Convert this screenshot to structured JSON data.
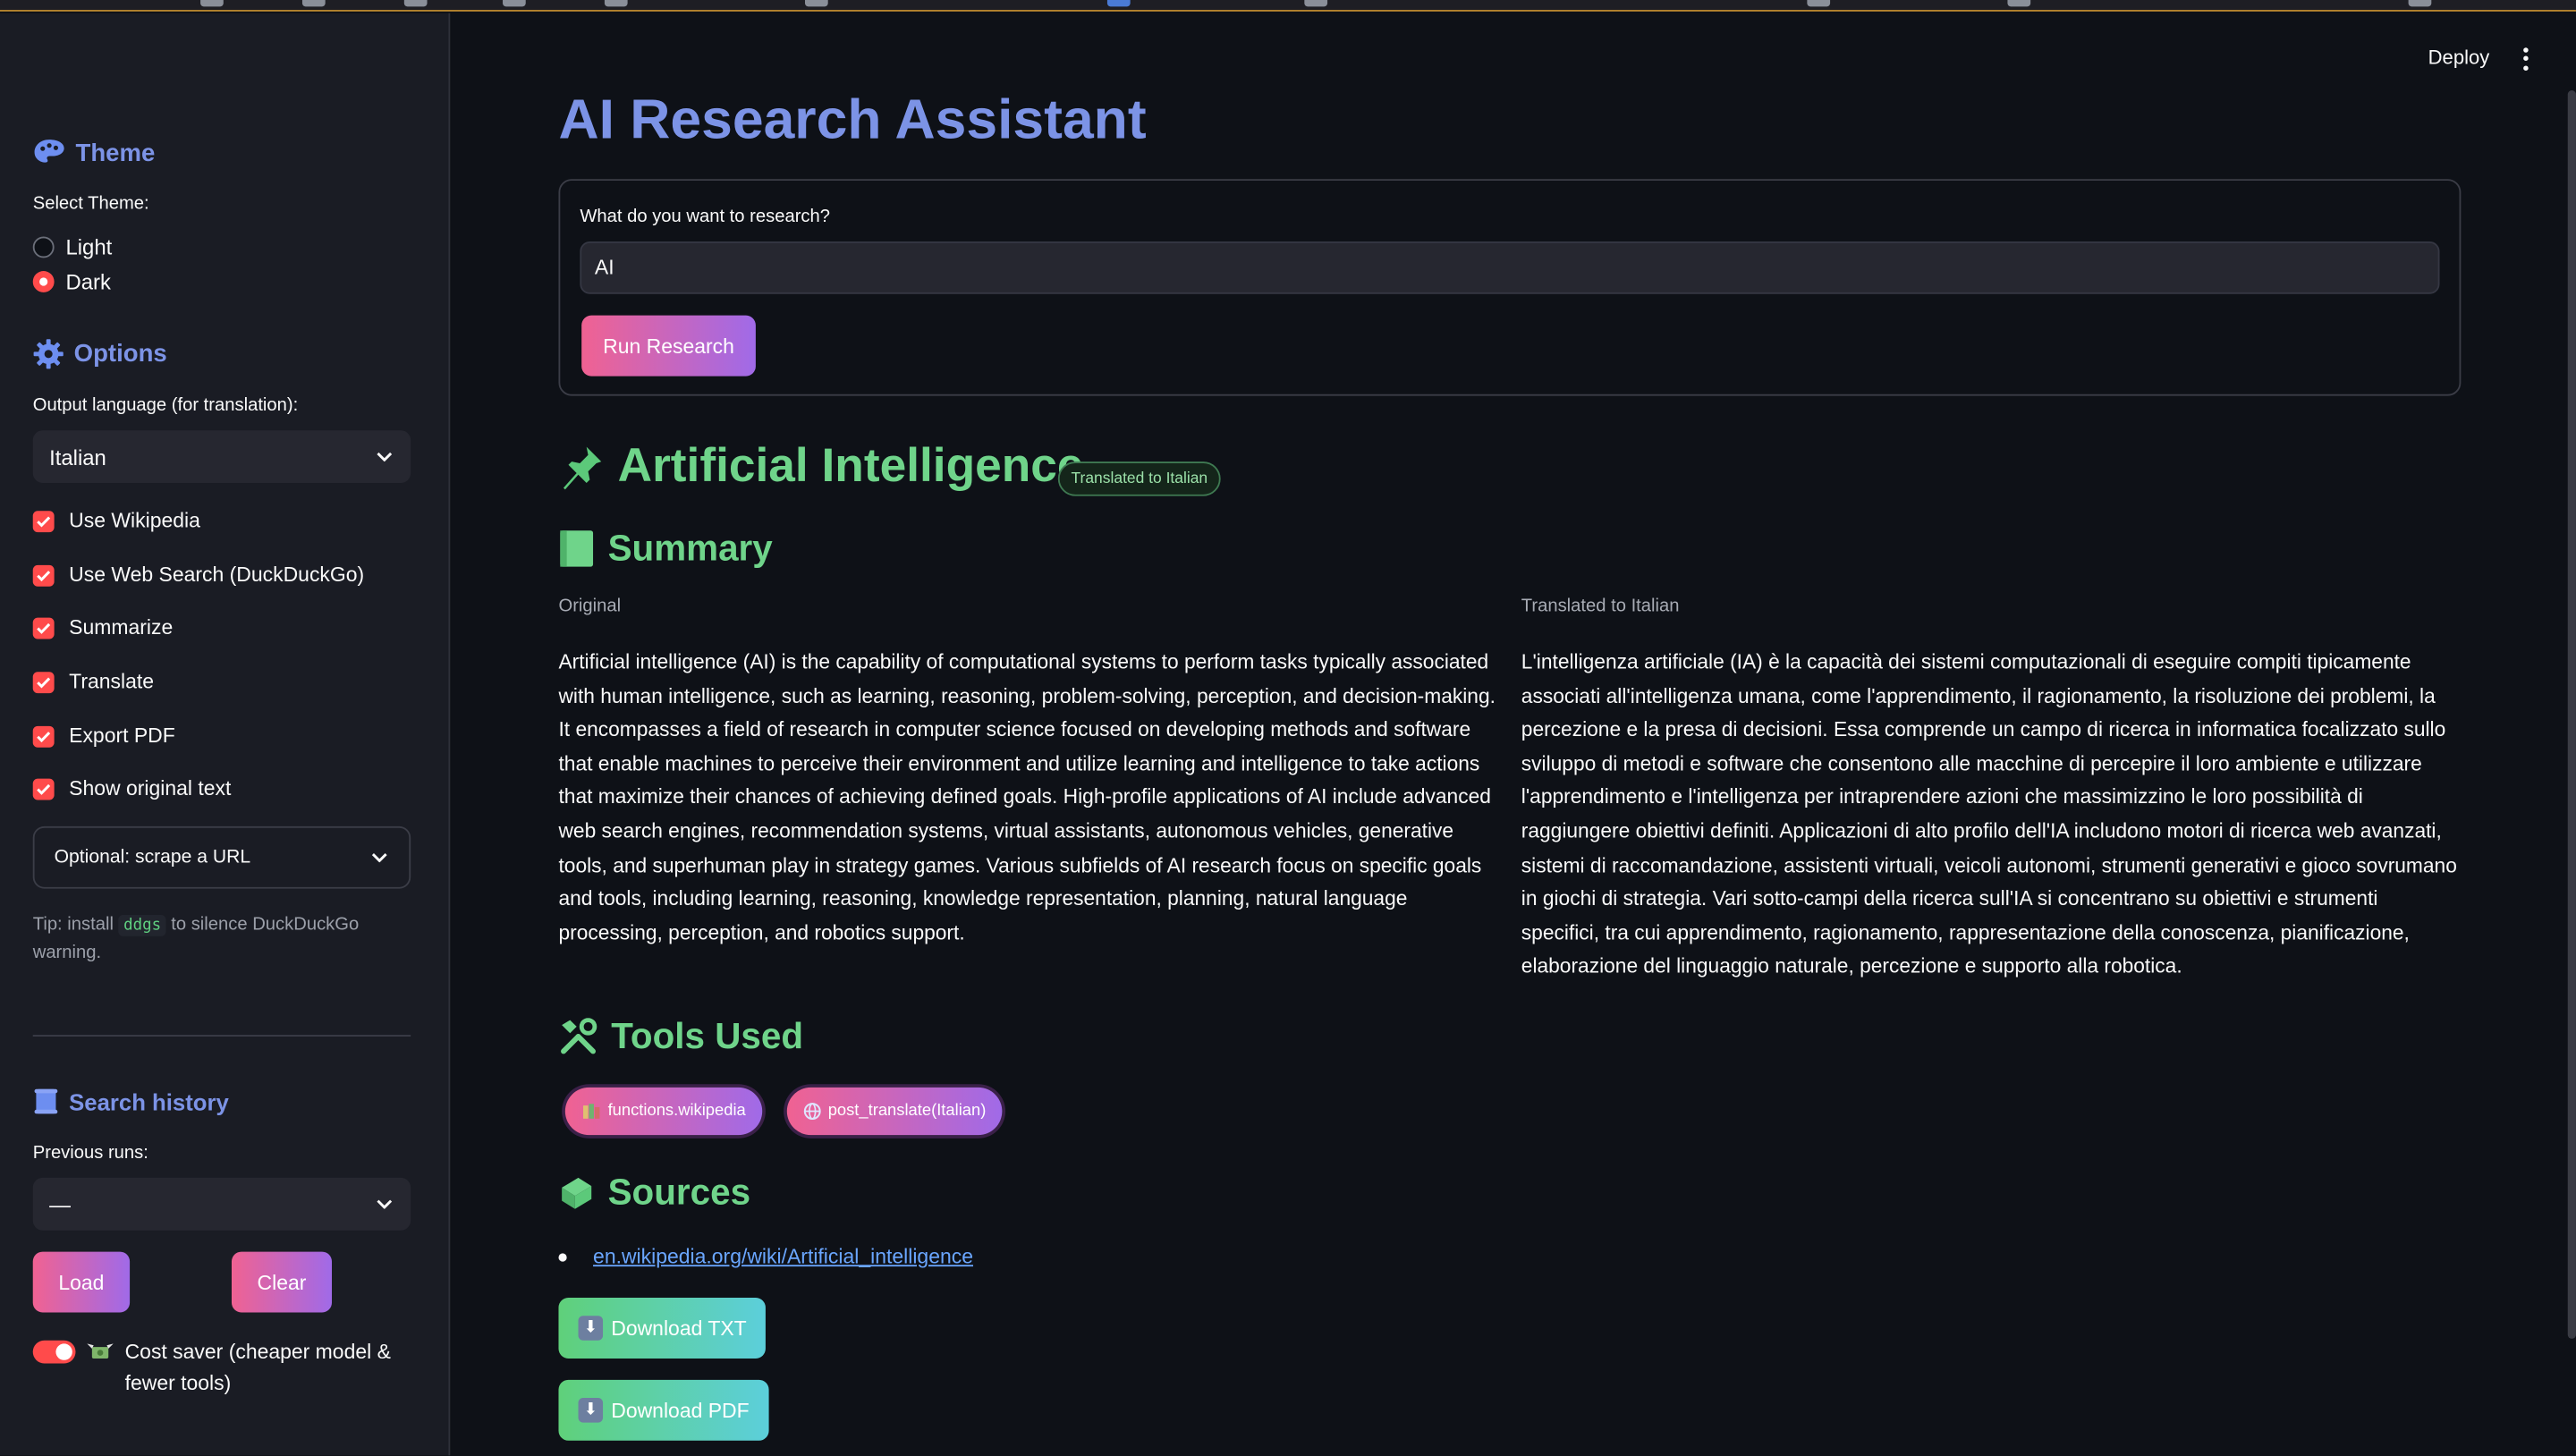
{
  "app": {
    "deploy_label": "Deploy"
  },
  "sidebar": {
    "theme": {
      "title": "Theme",
      "select_label": "Select Theme:",
      "options": [
        {
          "label": "Light",
          "selected": false
        },
        {
          "label": "Dark",
          "selected": true
        }
      ]
    },
    "options": {
      "title": "Options",
      "language_label": "Output language (for translation):",
      "language_value": "Italian",
      "checkboxes": [
        {
          "label": "Use Wikipedia",
          "checked": true
        },
        {
          "label": "Use Web Search (DuckDuckGo)",
          "checked": true
        },
        {
          "label": "Summarize",
          "checked": true
        },
        {
          "label": "Translate",
          "checked": true
        },
        {
          "label": "Export PDF",
          "checked": true
        },
        {
          "label": "Show original text",
          "checked": true
        }
      ],
      "scrape_expander": "Optional: scrape a URL",
      "tip_prefix": "Tip: install",
      "tip_code": "ddgs",
      "tip_suffix": "to silence DuckDuckGo warning."
    },
    "history": {
      "title": "Search history",
      "previous_label": "Previous runs:",
      "previous_value": "—",
      "load_label": "Load",
      "clear_label": "Clear"
    },
    "cost_saver": {
      "label": "Cost saver (cheaper model & fewer tools)",
      "on": true
    }
  },
  "main": {
    "title": "AI Research Assistant",
    "query_label": "What do you want to research?",
    "query_value": "AI",
    "run_label": "Run Research",
    "topic": "Artificial Intelligence",
    "badge": "Translated to Italian",
    "summary_title": "Summary",
    "original_header": "Original",
    "translated_header": "Translated to Italian",
    "original_text": "Artificial intelligence (AI) is the capability of computational systems to perform tasks typically associated with human intelligence, such as learning, reasoning, problem-solving, perception, and decision-making. It encompasses a field of research in computer science focused on developing methods and software that enable machines to perceive their environment and utilize learning and intelligence to take actions that maximize their chances of achieving defined goals. High-profile applications of AI include advanced web search engines, recommendation systems, virtual assistants, autonomous vehicles, generative tools, and superhuman play in strategy games. Various subfields of AI research focus on specific goals and tools, including learning, reasoning, knowledge representation, planning, natural language processing, perception, and robotics support.",
    "translated_text": "L'intelligenza artificiale (IA) è la capacità dei sistemi computazionali di eseguire compiti tipicamente associati all'intelligenza umana, come l'apprendimento, il ragionamento, la risoluzione dei problemi, la percezione e la presa di decisioni. Essa comprende un campo di ricerca in informatica focalizzato sullo sviluppo di metodi e software che consentono alle macchine di percepire il loro ambiente e utilizzare l'apprendimento e l'intelligenza per intraprendere azioni che massimizzino le loro possibilità di raggiungere obiettivi definiti. Applicazioni di alto profilo dell'IA includono motori di ricerca web avanzati, sistemi di raccomandazione, assistenti virtuali, veicoli autonomi, strumenti generativi e gioco sovrumano in giochi di strategia. Vari sotto-campi della ricerca sull'IA si concentrano su obiettivi e strumenti specifici, tra cui apprendimento, ragionamento, rappresentazione della conoscenza, pianificazione, elaborazione del linguaggio naturale, percezione e supporto alla robotica.",
    "tools_title": "Tools Used",
    "tools": [
      "functions.wikipedia",
      "post_translate(Italian)"
    ],
    "sources_title": "Sources",
    "sources": [
      "en.wikipedia.org/wiki/Artificial_intelligence"
    ],
    "download_txt": "Download TXT",
    "download_pdf": "Download PDF"
  },
  "icons": {
    "theme": "palette-icon",
    "options": "gear-icon",
    "history": "scroll-icon",
    "topic": "pushpin-icon",
    "summary": "notebook-icon",
    "tools": "tools-icon",
    "sources": "books-icon",
    "cost": "money-wings-icon",
    "download": "download-arrow-icon"
  },
  "colors": {
    "accent_blue": "#7c93e6",
    "accent_green": "#6fd48a",
    "primary_red": "#ff4b4b",
    "link": "#6aa6ff"
  }
}
